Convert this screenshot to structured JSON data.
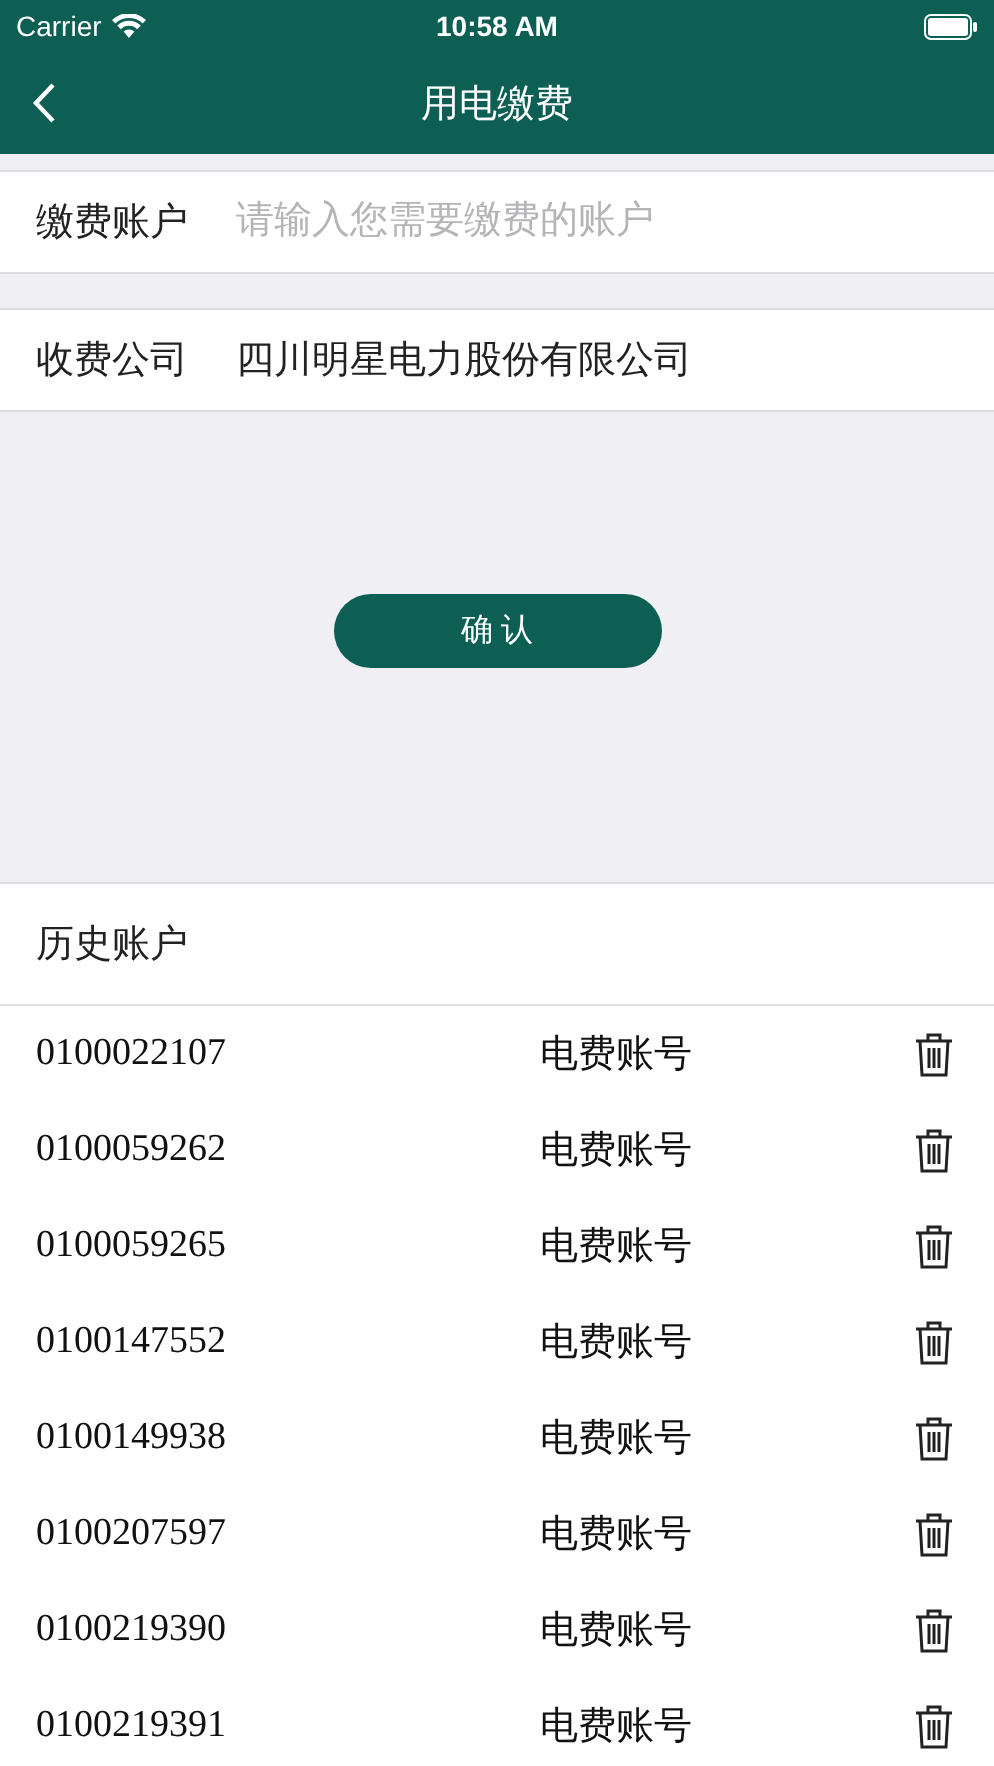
{
  "status_bar": {
    "carrier": "Carrier",
    "time": "10:58 AM"
  },
  "nav": {
    "title": "用电缴费"
  },
  "account_field": {
    "label": "缴费账户",
    "placeholder": "请输入您需要缴费的账户"
  },
  "company": {
    "label": "收费公司",
    "value": "四川明星电力股份有限公司"
  },
  "confirm_button": "确 认",
  "history": {
    "title": "历史账户",
    "rows": [
      {
        "account": "0100022107",
        "type": "电费账号"
      },
      {
        "account": "0100059262",
        "type": "电费账号"
      },
      {
        "account": "0100059265",
        "type": "电费账号"
      },
      {
        "account": "0100147552",
        "type": "电费账号"
      },
      {
        "account": "0100149938",
        "type": "电费账号"
      },
      {
        "account": "0100207597",
        "type": "电费账号"
      },
      {
        "account": "0100219390",
        "type": "电费账号"
      },
      {
        "account": "0100219391",
        "type": "电费账号"
      }
    ]
  }
}
